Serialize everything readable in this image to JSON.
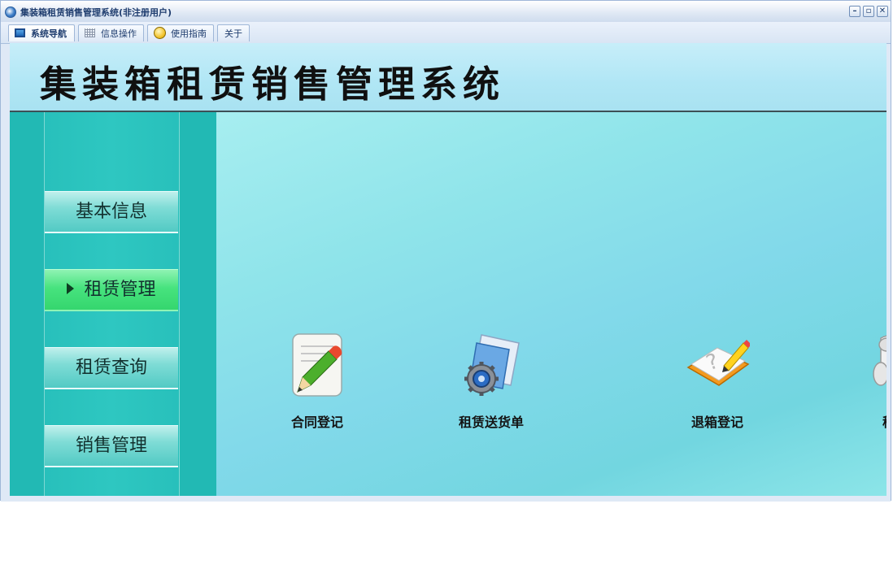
{
  "window": {
    "title": "集装箱租赁销售管理系统(非注册用户)",
    "controls": {
      "minimize": "–",
      "restore": "▫",
      "close": "✕"
    }
  },
  "tabs": [
    {
      "label": "系统导航",
      "icon": "monitor-icon",
      "active": true
    },
    {
      "label": "信息操作",
      "icon": "grid-icon",
      "active": false
    },
    {
      "label": "使用指南",
      "icon": "help-circle-icon",
      "active": false
    },
    {
      "label": "关于",
      "icon": "",
      "active": false
    }
  ],
  "header": {
    "title": "集装箱租赁销售管理系统"
  },
  "sidebar": {
    "items": [
      {
        "label": "基本信息",
        "active": false
      },
      {
        "label": "租赁管理",
        "active": true
      },
      {
        "label": "租赁查询",
        "active": false
      },
      {
        "label": "销售管理",
        "active": false
      }
    ]
  },
  "functions": [
    {
      "label": "合同登记",
      "icon": "contract-pencil-icon"
    },
    {
      "label": "租赁送货单",
      "icon": "delivery-gear-doc-icon"
    },
    {
      "label": "退箱登记",
      "icon": "return-book-icon"
    },
    {
      "label": "移箱",
      "icon": "scroll-move-icon"
    }
  ],
  "colors": {
    "sidebar": "#22b9b4",
    "menu_active": "#47e37e",
    "header_bg": "#b0e6f5",
    "main_bg": "#82d9ea"
  }
}
